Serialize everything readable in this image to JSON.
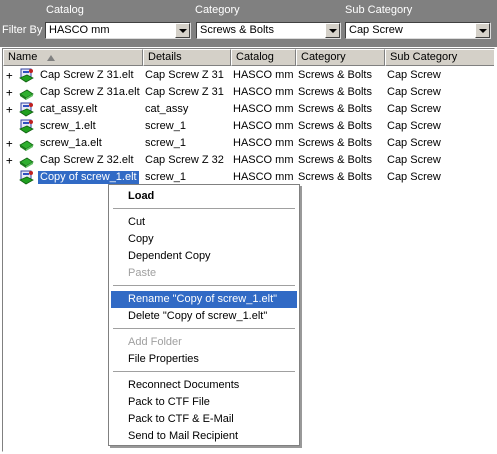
{
  "filters": {
    "filter_by_label": "Filter By",
    "catalog": {
      "label": "Catalog",
      "value": "HASCO mm"
    },
    "category": {
      "label": "Category",
      "value": "Screws & Bolts"
    },
    "sub_category": {
      "label": "Sub Category",
      "value": "Cap Screw"
    }
  },
  "columns": [
    "Name",
    "Details",
    "Catalog",
    "Category",
    "Sub Category"
  ],
  "rows": [
    {
      "expander": "+",
      "icon": "assembly-icon",
      "name": "Cap Screw Z 31.elt",
      "details": "Cap Screw Z 31",
      "catalog": "HASCO mm",
      "category": "Screws & Bolts",
      "sub": "Cap Screw"
    },
    {
      "expander": "+",
      "icon": "part-icon",
      "name": "Cap Screw Z 31a.elt",
      "details": "Cap Screw Z 31",
      "catalog": "HASCO mm",
      "category": "Screws & Bolts",
      "sub": "Cap Screw"
    },
    {
      "expander": "+",
      "icon": "assembly-icon",
      "name": "cat_assy.elt",
      "details": "cat_assy",
      "catalog": "HASCO mm",
      "category": "Screws & Bolts",
      "sub": "Cap Screw"
    },
    {
      "expander": "",
      "icon": "assembly-icon",
      "name": "screw_1.elt",
      "details": "screw_1",
      "catalog": "HASCO mm",
      "category": "Screws & Bolts",
      "sub": "Cap Screw"
    },
    {
      "expander": "+",
      "icon": "part-icon",
      "name": "screw_1a.elt",
      "details": "screw_1",
      "catalog": "HASCO mm",
      "category": "Screws & Bolts",
      "sub": "Cap Screw"
    },
    {
      "expander": "+",
      "icon": "part-icon",
      "name": "Cap Screw Z 32.elt",
      "details": "Cap Screw Z 32",
      "catalog": "HASCO mm",
      "category": "Screws & Bolts",
      "sub": "Cap Screw"
    },
    {
      "expander": "",
      "icon": "assembly-icon",
      "name": "Copy of screw_1.elt",
      "details": "screw_1",
      "catalog": "HASCO mm",
      "category": "Screws & Bolts",
      "sub": "Cap Screw"
    }
  ],
  "context_menu": {
    "load": "Load",
    "cut": "Cut",
    "copy": "Copy",
    "dependent_copy": "Dependent Copy",
    "paste": "Paste",
    "rename": "Rename \"Copy of screw_1.elt\"",
    "delete": "Delete \"Copy of screw_1.elt\"",
    "add_folder": "Add Folder",
    "file_properties": "File Properties",
    "reconnect": "Reconnect Documents",
    "pack_ctf": "Pack to CTF File",
    "pack_ctf_email": "Pack to CTF & E-Mail",
    "send_mail": "Send to Mail Recipient"
  },
  "colors": {
    "selection": "#316ac5",
    "toolbar": "#808080",
    "face": "#d4d0c8"
  }
}
